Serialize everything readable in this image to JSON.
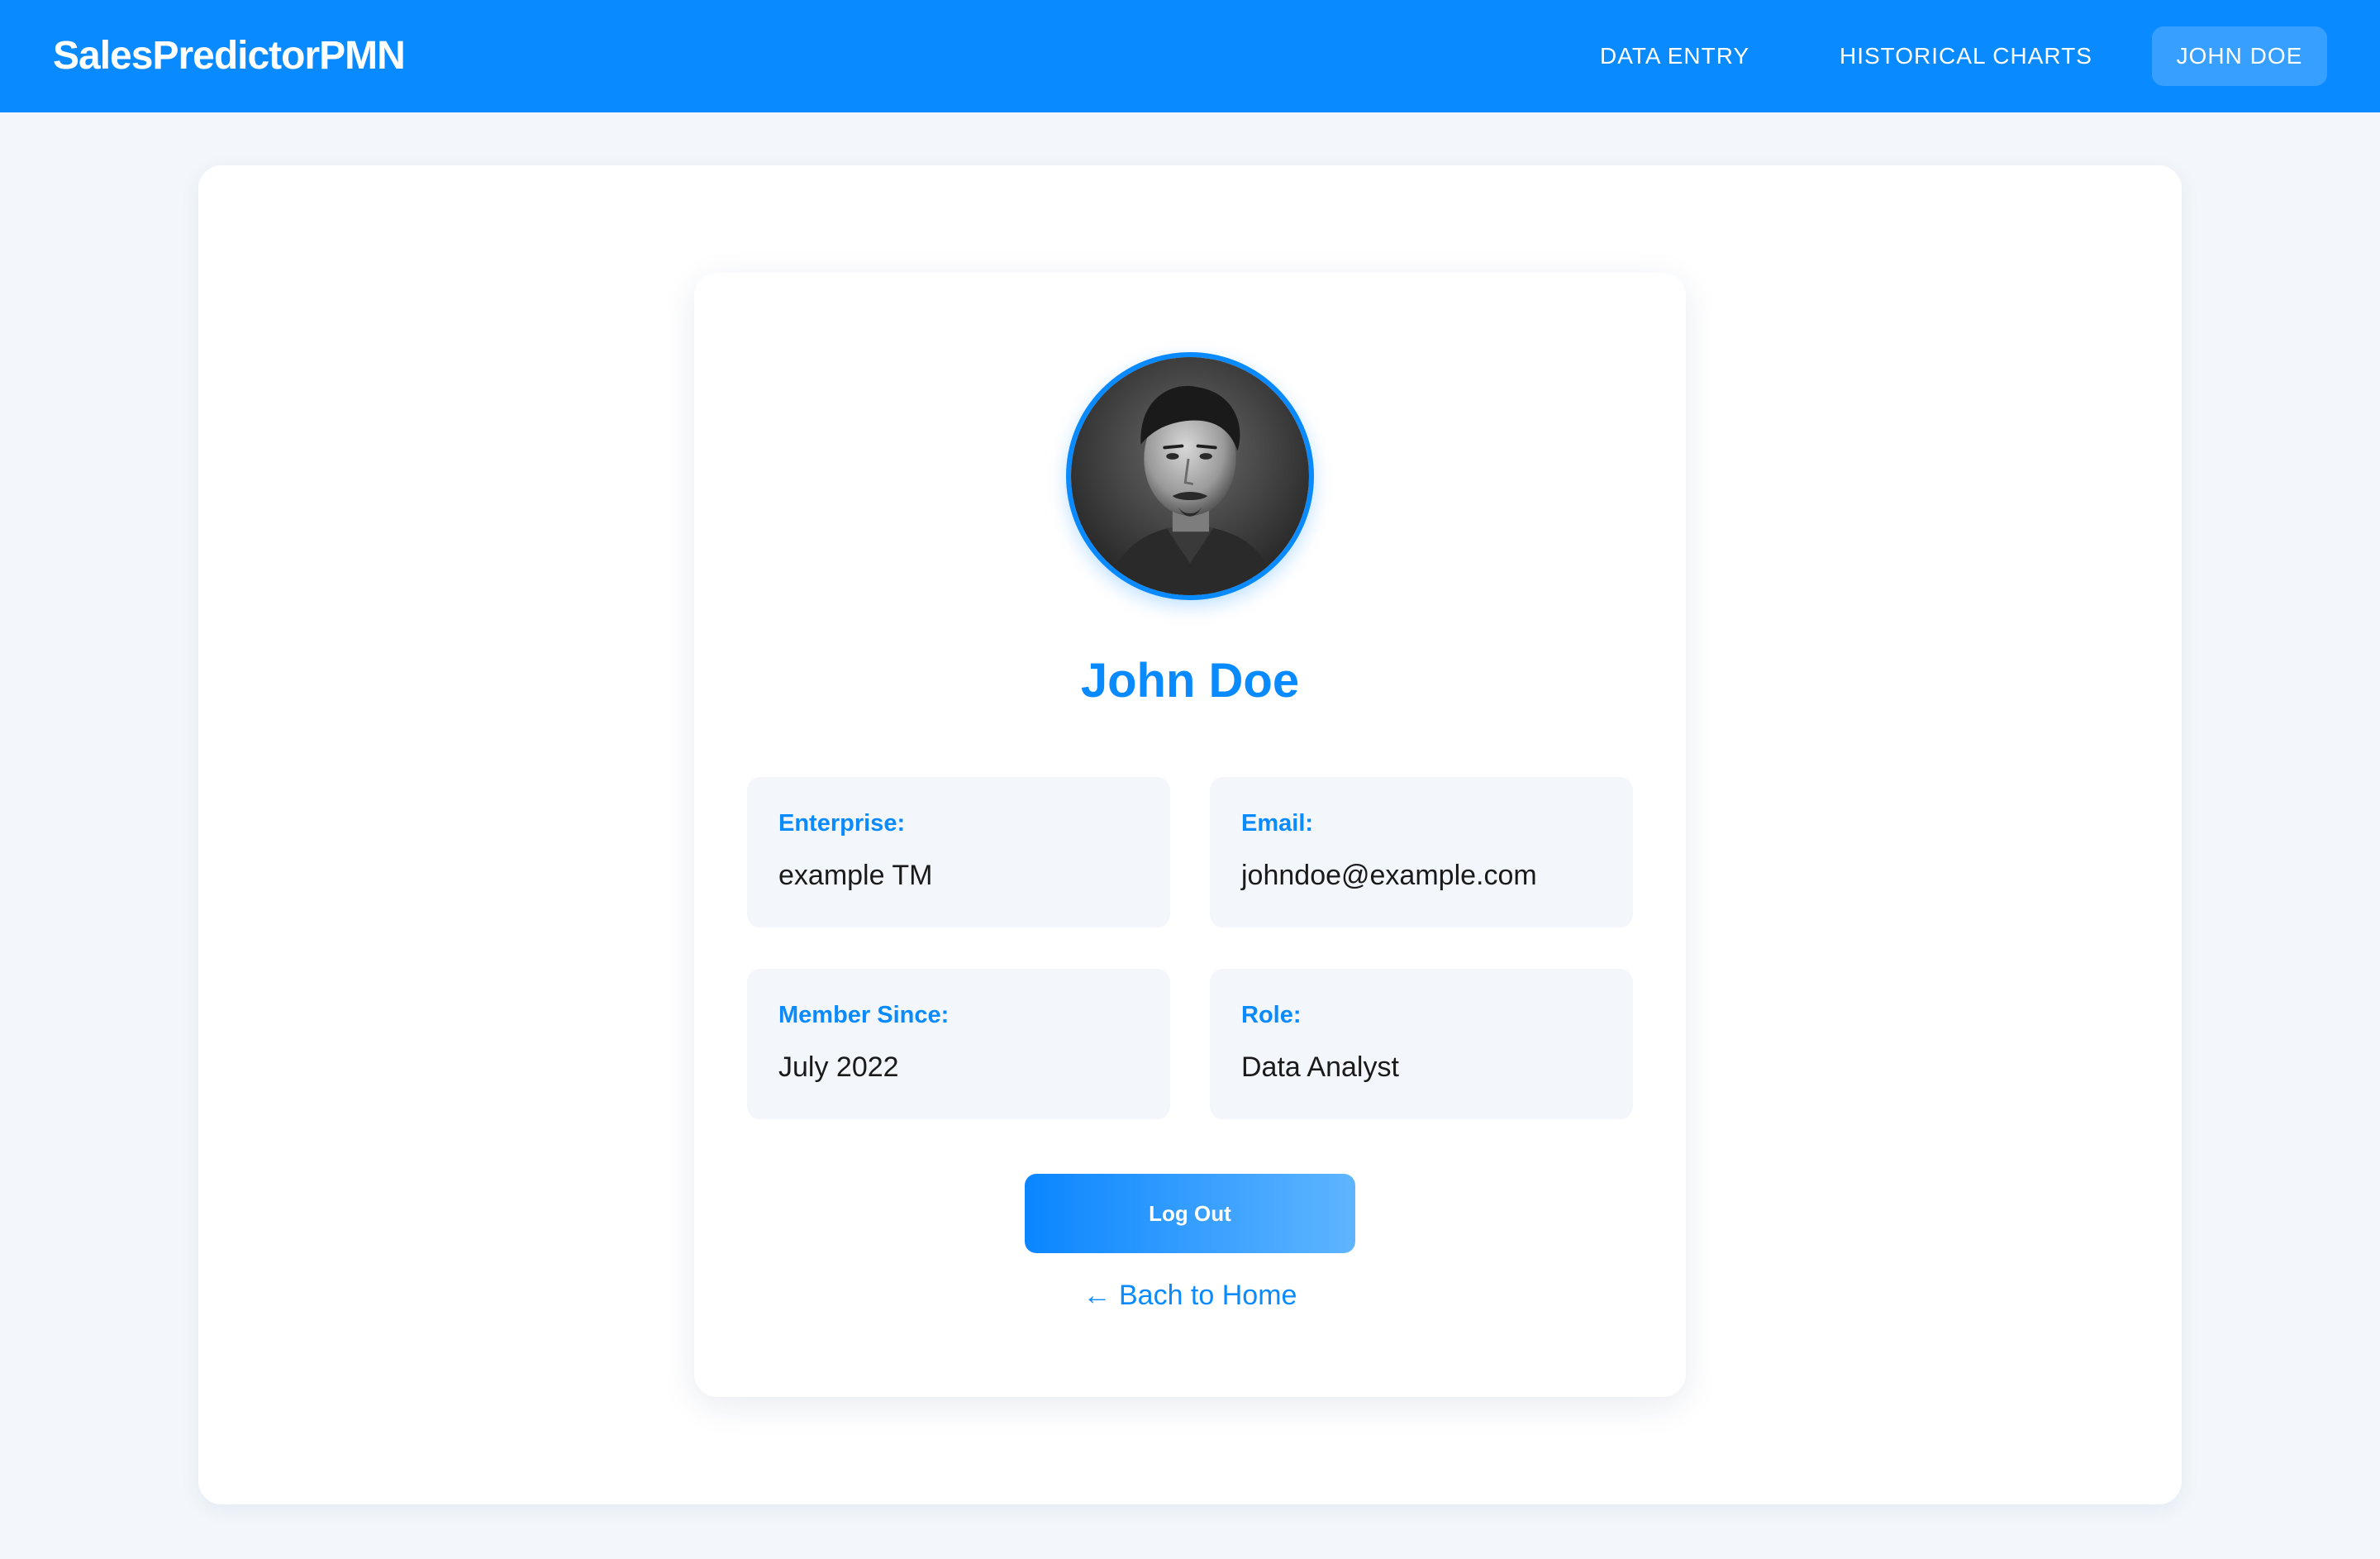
{
  "header": {
    "brand": "SalesPredictorPMN",
    "nav": {
      "data_entry": "DATA ENTRY",
      "historical_charts": "HISTORICAL CHARTS",
      "user": "JOHN DOE"
    }
  },
  "profile": {
    "avatar_icon": "profile-photo",
    "name": "John Doe",
    "fields": {
      "enterprise": {
        "label": "Enterprise:",
        "value": "example TM"
      },
      "email": {
        "label": "Email:",
        "value": "johndoe@example.com"
      },
      "member_since": {
        "label": "Member Since:",
        "value": "July 2022"
      },
      "role": {
        "label": "Role:",
        "value": "Data Analyst"
      }
    },
    "logout_label": "Log Out",
    "back_link": "← Bach to Home"
  },
  "colors": {
    "accent": "#0a8aff",
    "page_background": "#f3f7fb",
    "card": "#ffffff",
    "text": "#1a1a1a"
  }
}
